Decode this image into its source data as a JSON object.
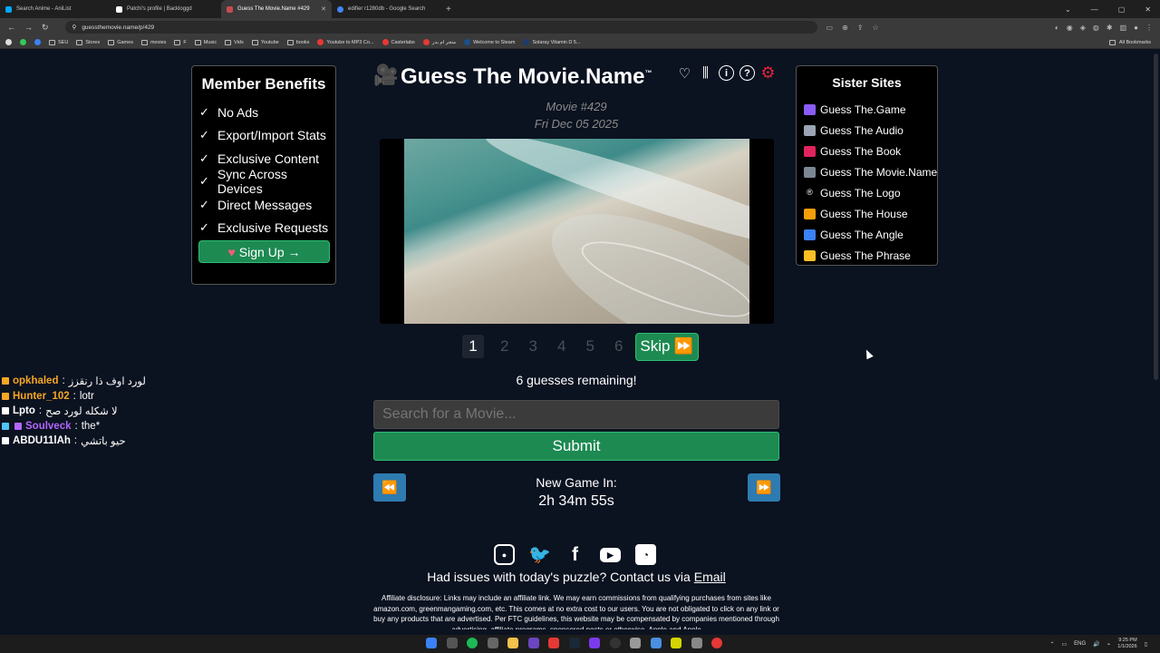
{
  "browser": {
    "tabs": [
      {
        "label": "Search Anime - AniList",
        "color": "#0b1622",
        "active": false
      },
      {
        "label": "Patchi's profile | Backloggd",
        "color": "#ffffff",
        "active": false
      },
      {
        "label": "Guess The Movie.Name #429",
        "color": "#c74b50",
        "active": true
      },
      {
        "label": "edifier r1280db - Google Search",
        "color": "#4285f4",
        "active": false
      }
    ],
    "new_tab_label": "+",
    "url": "guessthemovie.name/p/429",
    "bookmarks": [
      {
        "label": "SEU",
        "kind": "folder"
      },
      {
        "label": "Stores",
        "kind": "folder"
      },
      {
        "label": "Games",
        "kind": "folder"
      },
      {
        "label": "movies",
        "kind": "folder"
      },
      {
        "label": "F",
        "kind": "folder"
      },
      {
        "label": "Music",
        "kind": "folder"
      },
      {
        "label": "Vids",
        "kind": "folder"
      },
      {
        "label": "Youtube",
        "kind": "folder"
      },
      {
        "label": "books",
        "kind": "folder"
      },
      {
        "label": "Youtube to MP3 Co...",
        "kind": "site"
      },
      {
        "label": "Casterlabs",
        "kind": "site"
      },
      {
        "label": "متجر ام بدر",
        "kind": "site"
      },
      {
        "label": "Welcome to Steam",
        "kind": "site"
      },
      {
        "label": "Solaray Vitamin D 5...",
        "kind": "site"
      }
    ],
    "all_bookmarks_label": "All Bookmarks"
  },
  "benefits": {
    "title": "Member Benefits",
    "items": [
      "No Ads",
      "Export/Import Stats",
      "Exclusive Content",
      "Sync Across Devices",
      "Direct Messages",
      "Exclusive Requests"
    ],
    "check": "✓",
    "signup_label": "Sign Up →",
    "signup_icon": "heart-icon"
  },
  "game": {
    "title": "Guess The Movie.Name",
    "trademark": "™",
    "movie_number": "Movie #429",
    "date": "Fri Dec 05 2025",
    "pages": [
      "1",
      "2",
      "3",
      "4",
      "5",
      "6"
    ],
    "current_page": "1",
    "skip_label": "Skip",
    "remaining": "6 guesses remaining!",
    "search_placeholder": "Search for a Movie...",
    "submit_label": "Submit",
    "new_game_label": "New Game In:",
    "countdown": "2h 34m 55s"
  },
  "footer": {
    "contact_text": "Had issues with today's puzzle? Contact us via ",
    "contact_link": "Email",
    "disclosure": "Affiliate disclosure: Links may include an affiliate link. We may earn commissions from qualifying purchases from sites like amazon.com, greenmangaming.com, etc. This comes at no extra cost to our users. You are not obligated to click on any link or buy any products that are advertised. Per FTC guidelines, this website may be compensated by companies mentioned through advertising, affiliate programs, sponsored posts or otherwise. Apple and Apple"
  },
  "sister": {
    "title": "Sister Sites",
    "items": [
      {
        "label": "Guess The.Game",
        "icon": "gamepad-icon",
        "color": "#8a5cf6"
      },
      {
        "label": "Guess The Audio",
        "icon": "speaker-icon",
        "color": "#9aa4b2"
      },
      {
        "label": "Guess The Book",
        "icon": "book-icon",
        "color": "#e0245e"
      },
      {
        "label": "Guess The Movie.Name",
        "icon": "film-icon",
        "color": "#7c8794"
      },
      {
        "label": "Guess The Logo",
        "icon": "registered-icon",
        "color": "#ffffff"
      },
      {
        "label": "Guess The House",
        "icon": "house-icon",
        "color": "#f59e0b"
      },
      {
        "label": "Guess The Angle",
        "icon": "triangle-ruler-icon",
        "color": "#3b82f6"
      },
      {
        "label": "Guess The Phrase",
        "icon": "writing-hand-icon",
        "color": "#fbbf24"
      }
    ]
  },
  "chat": [
    {
      "user": "opkhaled",
      "message": "لورد اوف ذا رنقزز",
      "color": "#f5a623"
    },
    {
      "user": "Hunter_102",
      "message": "lotr",
      "color": "#f5a623"
    },
    {
      "user": "Lpto",
      "message": "لا شكله لورد صح",
      "color": "#ffffff"
    },
    {
      "user": "Soulveck",
      "message": "the*",
      "color": "#b366ff"
    },
    {
      "user": "ABDU11lAh",
      "message": "حيو باتشي",
      "color": "#ffffff"
    }
  ],
  "taskbar": {
    "language": "ENG",
    "time": "9:25 PM",
    "date": "1/1/2026"
  },
  "colors": {
    "page_bg": "#0b1220",
    "accent_green": "#1d8a52",
    "nav_blue": "#2d7bb0",
    "gear_red": "#e0243a"
  }
}
